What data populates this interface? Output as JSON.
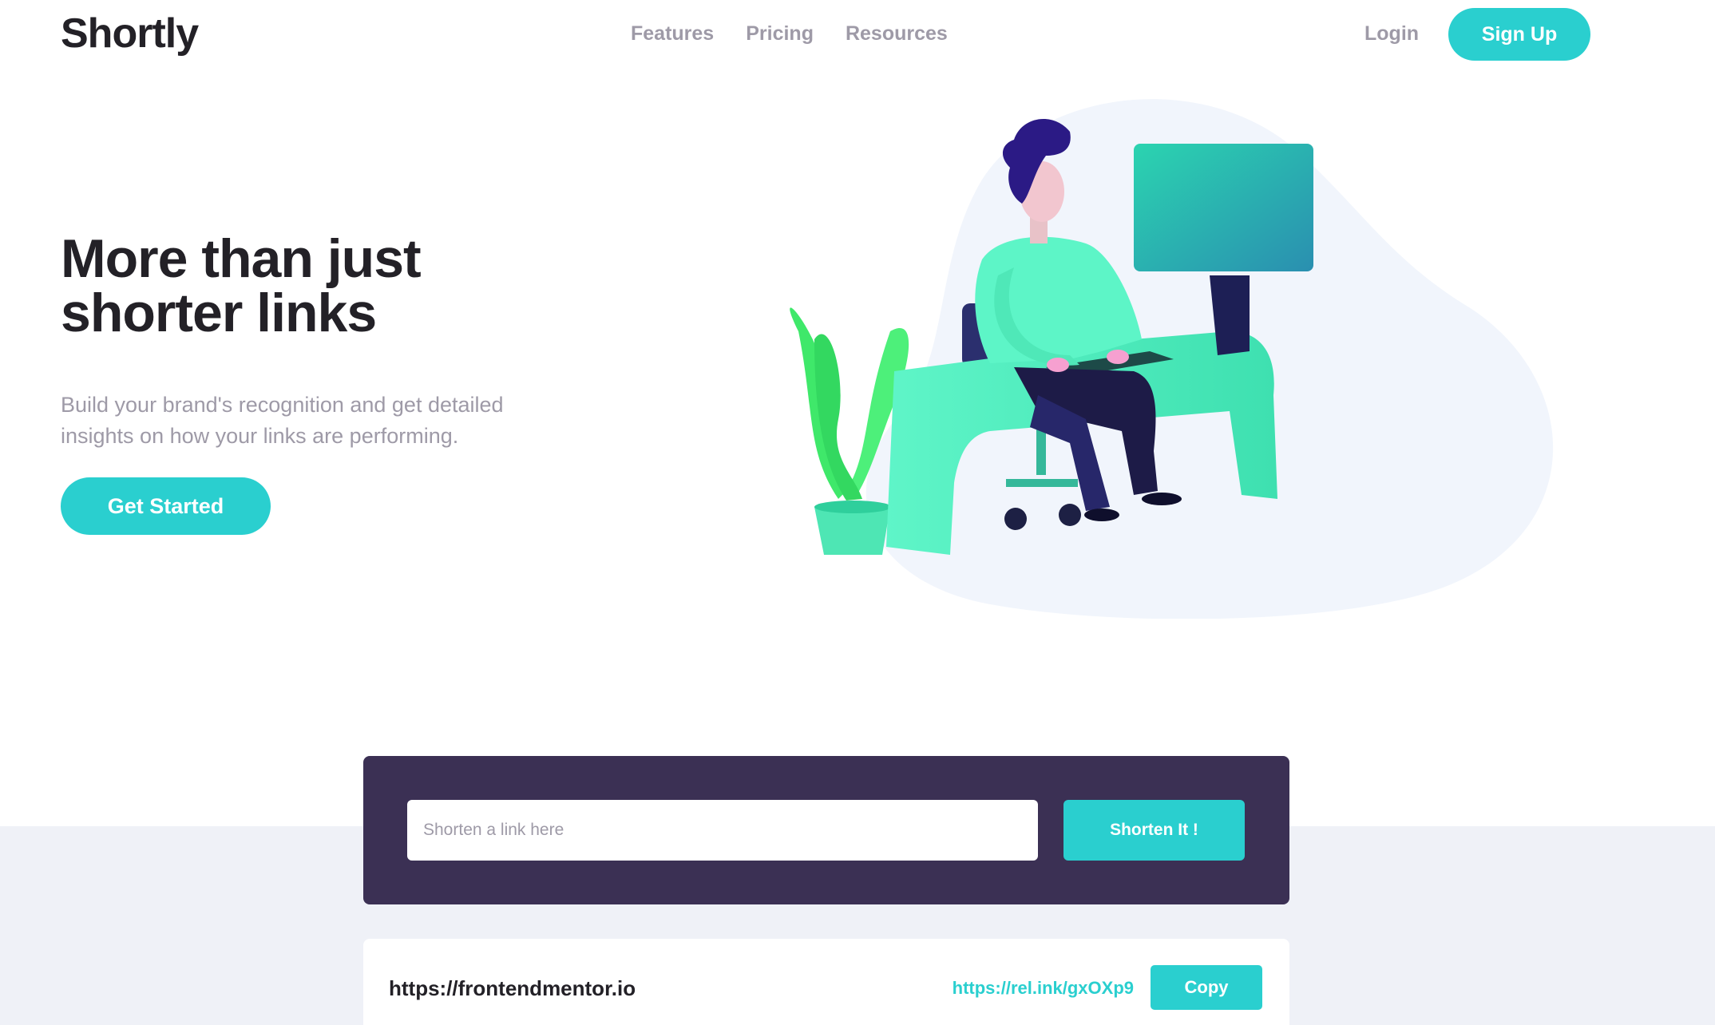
{
  "header": {
    "logo": "Shortly",
    "nav": [
      {
        "label": "Features"
      },
      {
        "label": "Pricing"
      },
      {
        "label": "Resources"
      }
    ],
    "login_label": "Login",
    "signup_label": "Sign Up"
  },
  "hero": {
    "title": "More than just shorter links",
    "subtitle": "Build your brand's recognition and get detailed insights on how your links are performing.",
    "cta_label": "Get Started",
    "illustration_icon": "person-working-at-desk-illustration"
  },
  "shorten": {
    "placeholder": "Shorten a link here",
    "value": "",
    "button_label": "Shorten It !"
  },
  "results": [
    {
      "original": "https://frontendmentor.io",
      "short": "https://rel.ink/gxOXp9",
      "copy_label": "Copy"
    }
  ],
  "colors": {
    "accent": "#2acfcf",
    "dark_panel": "#3b3054",
    "text_dark": "#232127",
    "text_gray": "#9e9aa7",
    "band_gray": "#eff1f7"
  }
}
